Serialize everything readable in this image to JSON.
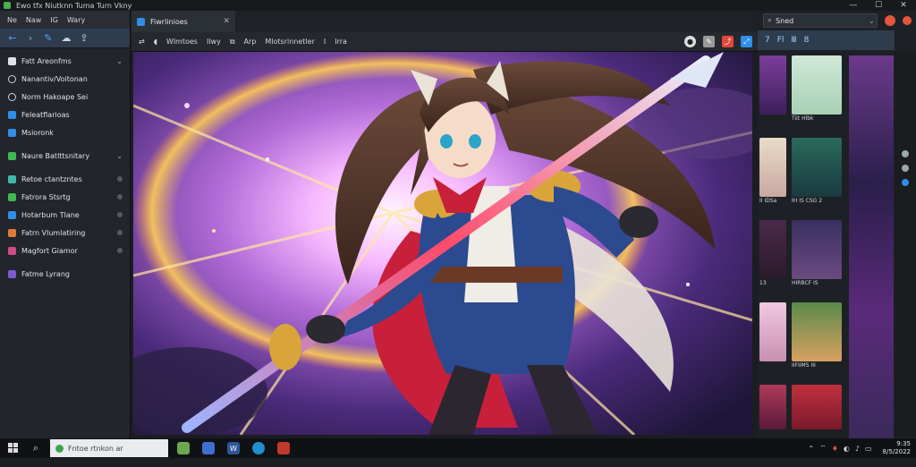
{
  "window": {
    "title": "Ewo tfx  Niutknn  Tuma  Turn  Vkny",
    "controls": [
      "—",
      "☐",
      "✕"
    ]
  },
  "left_panel": {
    "menu": [
      "Ne",
      "Naw",
      "IG",
      "Wary"
    ],
    "nav_icons": [
      "back-arrow-icon",
      "forward-arrow-icon",
      "pin-icon",
      "cloud-icon",
      "upload-icon"
    ],
    "items": [
      {
        "label": "Fatt Areonfms",
        "color": "#dfe3e8",
        "icon": "folder-icon",
        "expandable": true
      },
      {
        "label": "Nanantiv/Voitonan",
        "color": "#cfd3d9",
        "icon": "gear-icon"
      },
      {
        "label": "Norm Hakoape Sei",
        "color": "#cfd3d9",
        "icon": "gear-icon"
      },
      {
        "label": "Feleatflarioas",
        "color": "#2f8fe8",
        "icon": "document-icon"
      },
      {
        "label": "Msioronk",
        "color": "#2f8fe8",
        "icon": "document-icon"
      },
      {
        "label": "Naure Batlttsnitary",
        "color": "#3fb950",
        "icon": "folder-icon",
        "expandable": true
      },
      {
        "label": "Retoe ctantzntes",
        "color": "#3fb9a9",
        "icon": "app-icon"
      },
      {
        "label": "Fatrora Stsrtg",
        "color": "#3fb950",
        "icon": "app-icon"
      },
      {
        "label": "Hotarbum Tlane",
        "color": "#2f8fe8",
        "icon": "app-icon"
      },
      {
        "label": "Fatrn Vlumlatiring",
        "color": "#e07a3a",
        "icon": "app-icon"
      },
      {
        "label": "Magfort Giamor",
        "color": "#d04a8a",
        "icon": "app-icon"
      },
      {
        "label": "Fatme Lyrang",
        "color": "#7a5ad0",
        "icon": "app-icon"
      }
    ]
  },
  "center": {
    "tab": {
      "label": "Fiwrlinioes"
    },
    "toolbar": [
      "Wlmtoes",
      "Ilwy",
      "Arp",
      "Mlotsrinnetler",
      "I",
      "Irra"
    ],
    "toolbar_right_colors": [
      "#dddddd",
      "#999999",
      "#e0493a",
      "#2f8fe8"
    ],
    "image_desc_colors": {
      "sky": "#3a1f6a",
      "burst": "#ffd9ff",
      "coat": "#2c4a8f",
      "spear": "#c9d3e8"
    }
  },
  "right_panel": {
    "search": {
      "value": "Sned"
    },
    "tools": [
      "7",
      "Fl",
      "Ⅲ",
      "8"
    ],
    "captions": [
      [
        "",
        "Tiit Hlbk"
      ],
      [
        "II IDSa",
        "IH IS CSG 2"
      ],
      [
        "13",
        "HIRBCF IS"
      ],
      [
        "",
        "IIFIIMS III"
      ],
      [
        "",
        ""
      ]
    ],
    "badges": [
      "",
      "",
      "",
      "",
      ""
    ]
  },
  "taskbar": {
    "search_value": "Fntoe rtnkon ar",
    "clock_time": "9:35",
    "clock_date": "8/5/2022"
  }
}
